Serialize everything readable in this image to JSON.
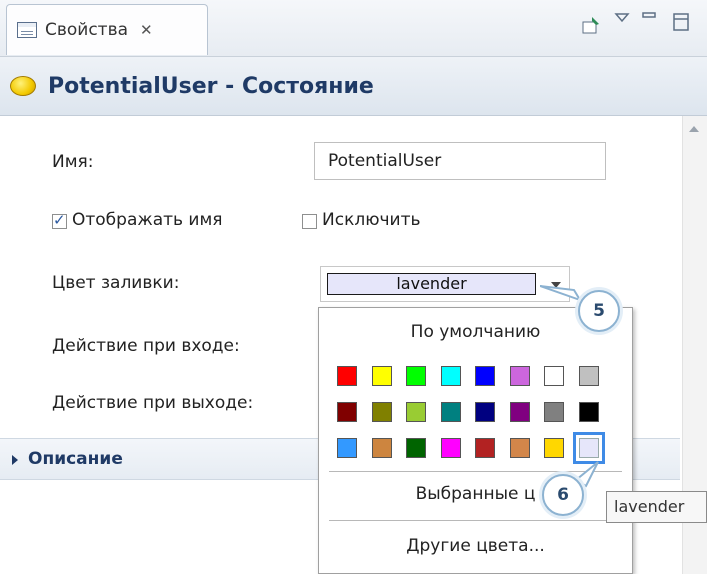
{
  "tab": {
    "label": "Свойства",
    "close": "✕"
  },
  "title": {
    "text": "PotentialUser - Состояние"
  },
  "form": {
    "name_label": "Имя:",
    "name_value": "PotentialUser",
    "show_name_label": "Отображать имя",
    "show_name_checked": true,
    "exclude_label": "Исключить",
    "exclude_checked": false,
    "fill_color_label": "Цвет заливки:",
    "fill_color_value": "lavender",
    "entry_action_label": "Действие при входе:",
    "exit_action_label": "Действие при выходе:"
  },
  "section": {
    "description_label": "Описание"
  },
  "color_popup": {
    "default_label": "По умолчанию",
    "rows": [
      [
        "#ff0000",
        "#ffff00",
        "#00ff00",
        "#00ffff",
        "#0000ff",
        "#cc66dd",
        "#ffffff",
        "#c0c0c0"
      ],
      [
        "#800000",
        "#808000",
        "#99cc33",
        "#008080",
        "#000080",
        "#800080",
        "#808080",
        "#000000"
      ],
      [
        "#3399ff",
        "#cd853f",
        "#006400",
        "#ff00ff",
        "#b22222",
        "#d2864a",
        "#ffd700",
        "#e6e6fa"
      ]
    ],
    "selected": "lavender",
    "chosen_colors_label": "Выбранные ц",
    "other_colors_label": "Другие цвета..."
  },
  "callouts": [
    "5",
    "6"
  ],
  "tooltip": {
    "text": "lavender"
  },
  "icons": [
    "properties-icon",
    "close-icon",
    "pin-icon",
    "view-menu-icon",
    "minimize-icon",
    "maximize-icon",
    "state-icon",
    "expand-arrow-icon",
    "dropdown-arrow-icon",
    "scroll-up-icon"
  ]
}
